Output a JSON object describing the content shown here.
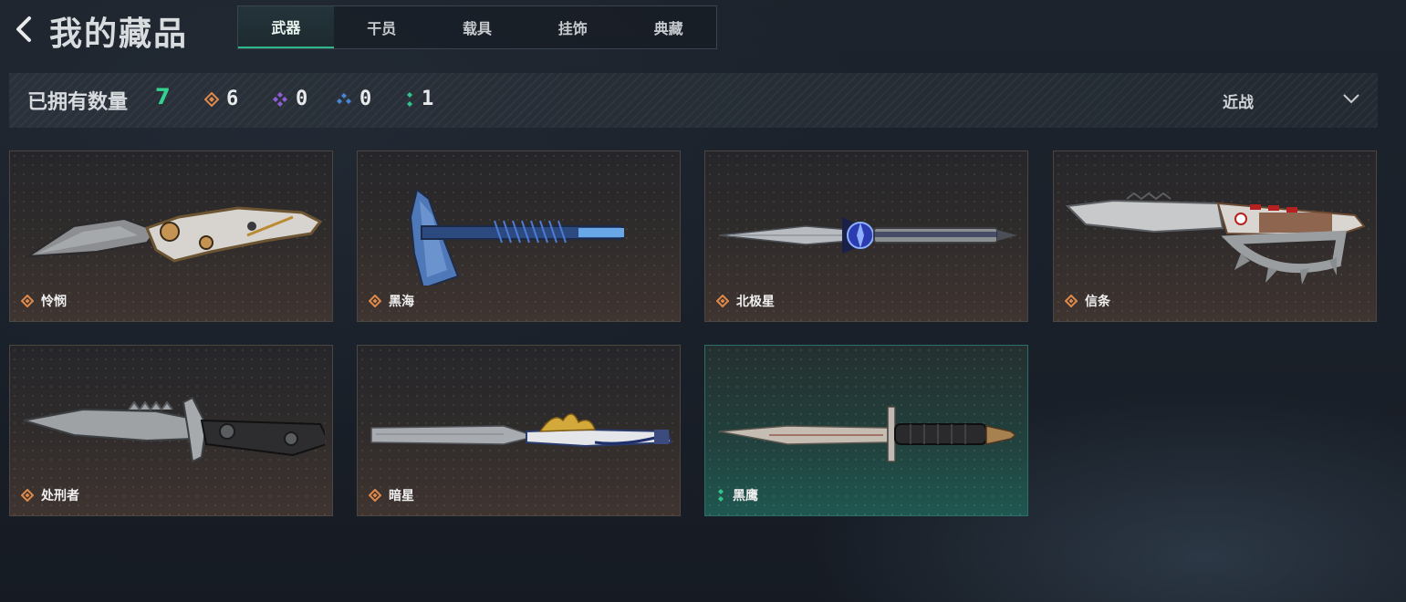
{
  "header": {
    "title": "我的藏品",
    "back_icon": "chevron-left-icon",
    "tabs": [
      {
        "label": "武器",
        "active": true
      },
      {
        "label": "干员",
        "active": false
      },
      {
        "label": "载具",
        "active": false
      },
      {
        "label": "挂饰",
        "active": false
      },
      {
        "label": "典藏",
        "active": false
      }
    ]
  },
  "stats": {
    "owned_label": "已拥有数量",
    "owned_count": "7",
    "rarities": [
      {
        "icon": "orange-diamond-icon",
        "color": "#e08a4a",
        "count": "6"
      },
      {
        "icon": "purple-diamond-icon",
        "color": "#8f5ed6",
        "count": "0"
      },
      {
        "icon": "blue-diamond-icon",
        "color": "#4a86d8",
        "count": "0"
      },
      {
        "icon": "green-dots-icon",
        "color": "#2fc58c",
        "count": "1"
      }
    ],
    "filter_label": "近战",
    "filter_icon": "chevron-down-icon"
  },
  "items": [
    {
      "name": "怜悯",
      "rarity": "orange"
    },
    {
      "name": "黑海",
      "rarity": "orange"
    },
    {
      "name": "北极星",
      "rarity": "orange"
    },
    {
      "name": "信条",
      "rarity": "orange"
    },
    {
      "name": "处刑者",
      "rarity": "orange"
    },
    {
      "name": "暗星",
      "rarity": "orange"
    },
    {
      "name": "黑鹰",
      "rarity": "green"
    }
  ],
  "colors": {
    "accent_green": "#34d28f",
    "rarity_orange": "#e08a4a",
    "rarity_green": "#2fc58c"
  }
}
